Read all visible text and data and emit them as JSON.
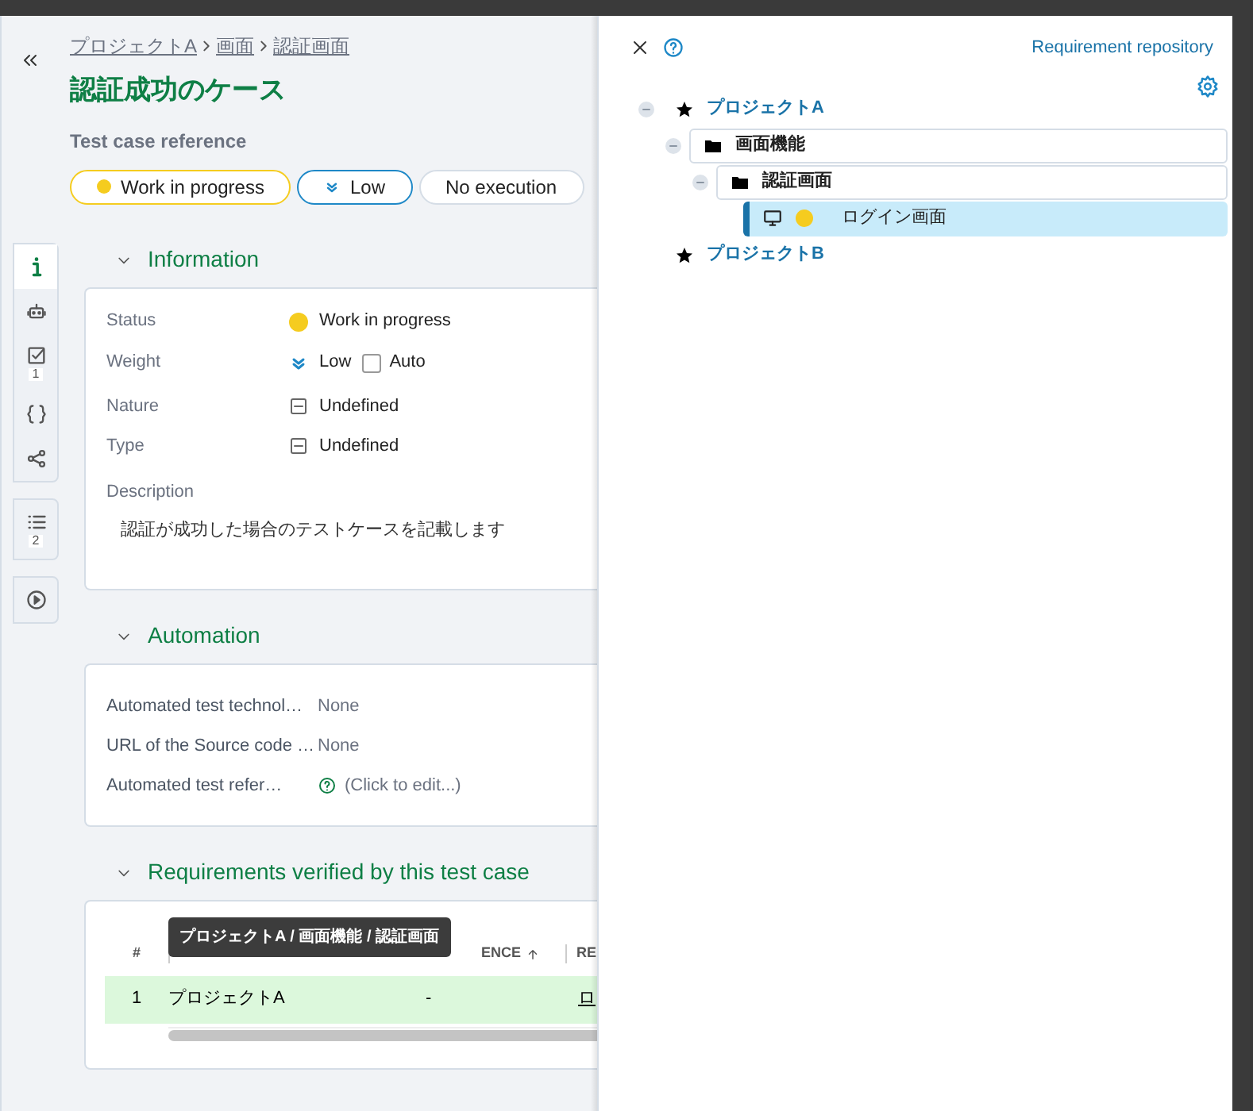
{
  "breadcrumb": [
    "プロジェクトA",
    "画面",
    "認証画面"
  ],
  "title": "認証成功のケース",
  "reference_label": "Test case reference",
  "chips": [
    {
      "kind": "status",
      "label": "Work in progress",
      "color": "#f5cc1f"
    },
    {
      "kind": "weight",
      "label": "Low"
    },
    {
      "kind": "plain",
      "label": "No execution"
    }
  ],
  "side_tabs": [
    {
      "kind": "info",
      "selected": true
    },
    {
      "kind": "robot",
      "selected": false
    },
    {
      "kind": "check",
      "count": "1",
      "selected": false
    },
    {
      "kind": "braces",
      "selected": false
    },
    {
      "kind": "share",
      "selected": false
    }
  ],
  "side_tabs_2": [
    {
      "kind": "list",
      "count": "2"
    }
  ],
  "side_tabs_3": [
    {
      "kind": "play"
    }
  ],
  "information": {
    "heading": "Information",
    "expanded": true,
    "fields": [
      {
        "kind": "status",
        "label": "Status",
        "value": "Work in progress",
        "color": "#f5cc1f"
      },
      {
        "kind": "weight",
        "label": "Weight",
        "value": "Low",
        "checkbox_label": "Auto",
        "checked": false
      },
      {
        "kind": "undefined",
        "label": "Nature",
        "value": "Undefined"
      },
      {
        "kind": "undefined",
        "label": "Type",
        "value": "Undefined"
      }
    ],
    "description_label": "Description",
    "description": "認証が成功した場合のテストケースを記載します"
  },
  "automation": {
    "heading": "Automation",
    "expanded": true,
    "fields": [
      {
        "label": "Automated test technol…",
        "value": "None"
      },
      {
        "label": "URL of the Source code …",
        "value": "None"
      },
      {
        "label": "Automated test refer…",
        "value": "(Click to edit...)",
        "help": true
      }
    ]
  },
  "requirements": {
    "heading": "Requirements verified by this test case",
    "expanded": true,
    "columns": [
      "#",
      "",
      "ENCE",
      "RE"
    ],
    "rows": [
      {
        "cells": [
          "1",
          "プロジェクトA",
          "-",
          "ロ"
        ],
        "selected": true
      }
    ],
    "tooltip": "プロジェクトA / 画面機能 / 認証画面"
  },
  "panel": {
    "title": "Requirement repository",
    "tree": [
      {
        "label": "プロジェクトA",
        "kind": "project",
        "expanded": true,
        "selected": false,
        "children": [
          {
            "label": "画面機能",
            "kind": "folder",
            "expanded": true,
            "selected": false,
            "children": [
              {
                "label": "認証画面",
                "kind": "folder",
                "expanded": true,
                "selected": false,
                "children": [
                  {
                    "label": "ログイン画面",
                    "kind": "requirement",
                    "color": "#f5cc1f",
                    "selected": true
                  }
                ]
              }
            ]
          }
        ]
      },
      {
        "label": "プロジェクトB",
        "kind": "project",
        "selected": false
      }
    ]
  }
}
